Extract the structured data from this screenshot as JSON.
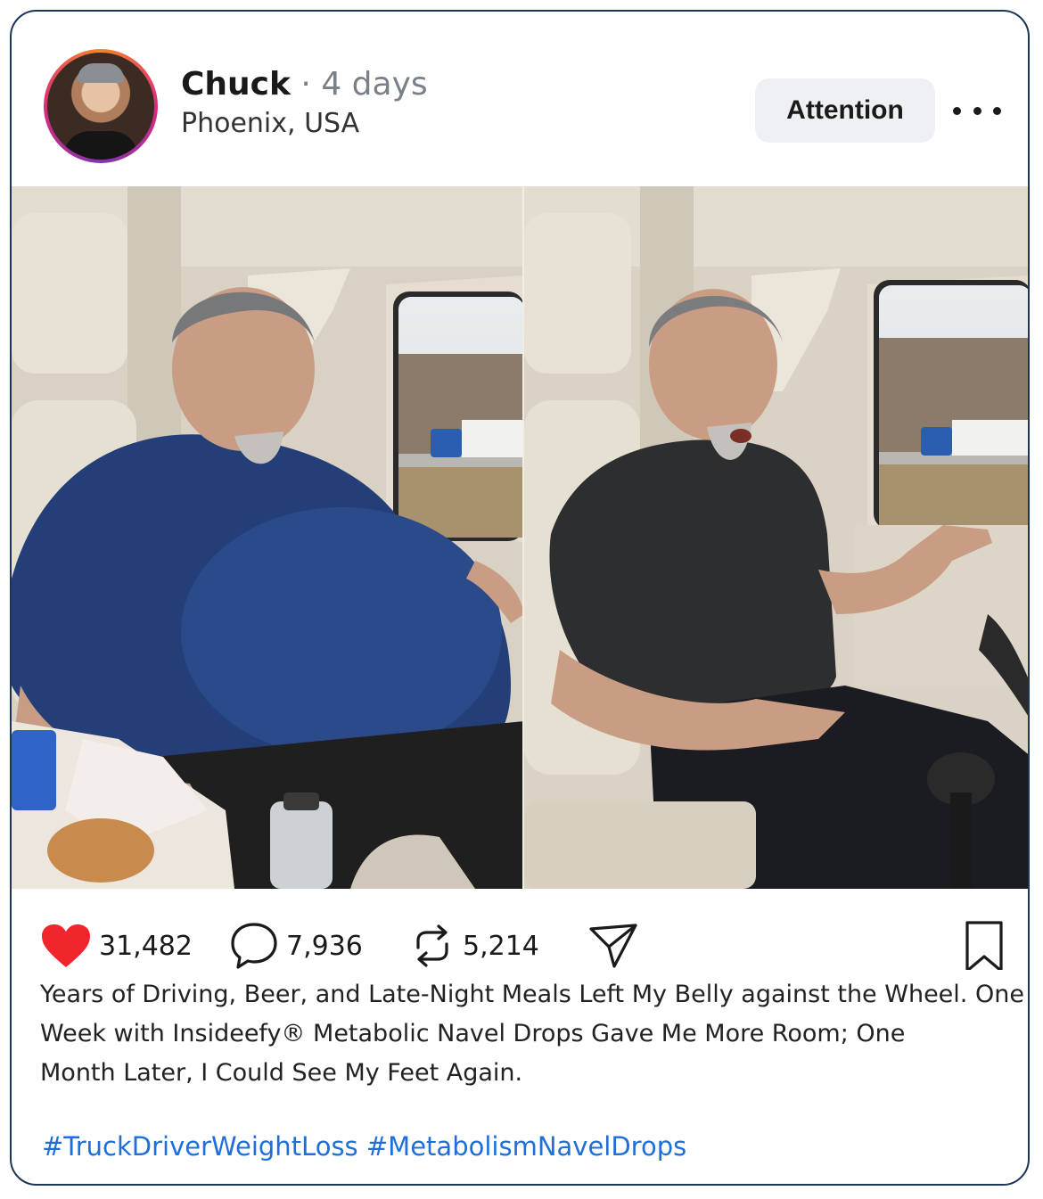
{
  "post": {
    "author": "Chuck",
    "separator": "·",
    "time_ago": "4 days",
    "location": "Phoenix, USA",
    "attention_label": "Attention",
    "more_icon": "more-horizontal-icon",
    "images": {
      "before_alt": "Before",
      "after_alt": "After"
    }
  },
  "actions": {
    "likes": "31,482",
    "comments": "7,936",
    "reposts": "5,214",
    "like_icon": "heart-icon",
    "comment_icon": "comment-icon",
    "repost_icon": "repost-icon",
    "share_icon": "share-icon",
    "save_icon": "bookmark-icon",
    "like_color": "#f0262c"
  },
  "caption": {
    "line1": "Years of Driving, Beer, and Late-Night Meals Left My Belly against the Wheel. One",
    "line2": "Week with Insideefy® Metabolic Navel Drops Gave Me More Room; One",
    "line3": "Month Later, I Could See My Feet Again."
  },
  "hashtags": "#TruckDriverWeightLoss #MetabolismNavelDrops",
  "colors": {
    "border": "#1d3557",
    "hashtag": "#1e6fd9",
    "button_bg": "#eef0f3"
  }
}
